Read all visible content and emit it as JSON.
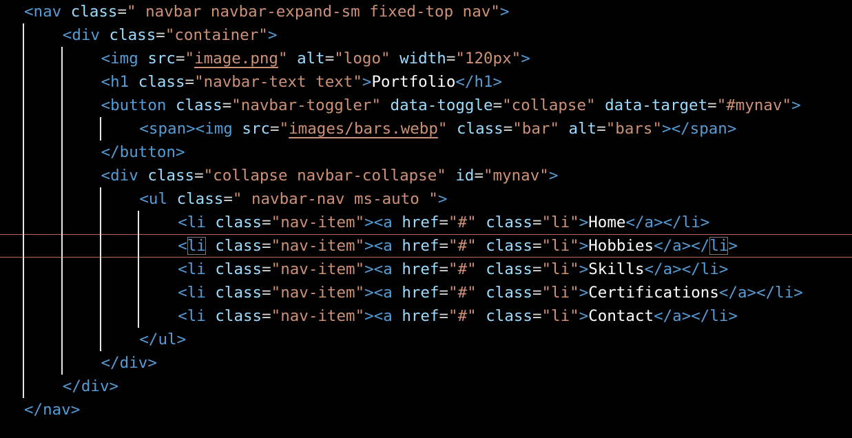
{
  "editor": {
    "lines": [
      [
        [
          "tag",
          "<nav "
        ],
        [
          "attr",
          "class"
        ],
        [
          "pun",
          "="
        ],
        [
          "str",
          "\" navbar navbar-expand-sm fixed-top nav\""
        ],
        [
          "tag",
          ">"
        ]
      ],
      [
        [
          "tag",
          "<div "
        ],
        [
          "attr",
          "class"
        ],
        [
          "pun",
          "="
        ],
        [
          "str",
          "\"container\""
        ],
        [
          "tag",
          ">"
        ]
      ],
      [
        [
          "tag",
          "<img "
        ],
        [
          "attr",
          "src"
        ],
        [
          "pun",
          "="
        ],
        [
          "str",
          "\""
        ],
        [
          "str",
          "image.png",
          "link"
        ],
        [
          "str",
          "\""
        ],
        [
          "pun",
          " "
        ],
        [
          "attr",
          "alt"
        ],
        [
          "pun",
          "="
        ],
        [
          "str",
          "\"logo\""
        ],
        [
          "pun",
          " "
        ],
        [
          "attr",
          "width"
        ],
        [
          "pun",
          "="
        ],
        [
          "str",
          "\"120px\""
        ],
        [
          "tag",
          ">"
        ]
      ],
      [
        [
          "tag",
          "<h1 "
        ],
        [
          "attr",
          "class"
        ],
        [
          "pun",
          "="
        ],
        [
          "str",
          "\"navbar-text text\""
        ],
        [
          "tag",
          ">"
        ],
        [
          "txt",
          "Portfolio"
        ],
        [
          "tag",
          "</h1>"
        ]
      ],
      [
        [
          "tag",
          "<button "
        ],
        [
          "attr",
          "class"
        ],
        [
          "pun",
          "="
        ],
        [
          "str",
          "\"navbar-toggler\""
        ],
        [
          "pun",
          " "
        ],
        [
          "attr",
          "data-toggle"
        ],
        [
          "pun",
          "="
        ],
        [
          "str",
          "\"collapse\""
        ],
        [
          "pun",
          " "
        ],
        [
          "attr",
          "data-target"
        ],
        [
          "pun",
          "="
        ],
        [
          "str",
          "\"#mynav\""
        ],
        [
          "tag",
          ">"
        ]
      ],
      [
        [
          "tag",
          "<span>"
        ],
        [
          "tag",
          "<img "
        ],
        [
          "attr",
          "src"
        ],
        [
          "pun",
          "="
        ],
        [
          "str",
          "\""
        ],
        [
          "str",
          "images/bars.webp",
          "link"
        ],
        [
          "str",
          "\""
        ],
        [
          "pun",
          " "
        ],
        [
          "attr",
          "class"
        ],
        [
          "pun",
          "="
        ],
        [
          "str",
          "\"bar\""
        ],
        [
          "pun",
          " "
        ],
        [
          "attr",
          "alt"
        ],
        [
          "pun",
          "="
        ],
        [
          "str",
          "\"bars\""
        ],
        [
          "tag",
          ">"
        ],
        [
          "tag",
          "</span>"
        ]
      ],
      [
        [
          "tag",
          "</button>"
        ]
      ],
      [
        [
          "tag",
          "<div "
        ],
        [
          "attr",
          "class"
        ],
        [
          "pun",
          "="
        ],
        [
          "str",
          "\"collapse navbar-collapse\""
        ],
        [
          "pun",
          " "
        ],
        [
          "attr",
          "id"
        ],
        [
          "pun",
          "="
        ],
        [
          "str",
          "\"mynav\""
        ],
        [
          "tag",
          ">"
        ]
      ],
      [
        [
          "tag",
          "<ul "
        ],
        [
          "attr",
          "class"
        ],
        [
          "pun",
          "="
        ],
        [
          "str",
          "\" navbar-nav ms-auto \""
        ],
        [
          "tag",
          ">"
        ]
      ],
      [
        [
          "tag",
          "<li "
        ],
        [
          "attr",
          "class"
        ],
        [
          "pun",
          "="
        ],
        [
          "str",
          "\"nav-item\""
        ],
        [
          "tag",
          ">"
        ],
        [
          "tag",
          "<a "
        ],
        [
          "attr",
          "href"
        ],
        [
          "pun",
          "="
        ],
        [
          "str",
          "\"#\""
        ],
        [
          "pun",
          " "
        ],
        [
          "attr",
          "class"
        ],
        [
          "pun",
          "="
        ],
        [
          "str",
          "\"li\""
        ],
        [
          "tag",
          ">"
        ],
        [
          "txt",
          "Home"
        ],
        [
          "tag",
          "</a>"
        ],
        [
          "tag",
          "</li>"
        ]
      ],
      [
        [
          "tag",
          "<"
        ],
        [
          "tag",
          "li",
          "pair"
        ],
        [
          "pun",
          " "
        ],
        [
          "attr",
          "class"
        ],
        [
          "pun",
          "="
        ],
        [
          "str",
          "\"nav-item\""
        ],
        [
          "tag",
          ">"
        ],
        [
          "tag",
          "<a "
        ],
        [
          "attr",
          "href"
        ],
        [
          "pun",
          "="
        ],
        [
          "str",
          "\"#\""
        ],
        [
          "pun",
          " "
        ],
        [
          "attr",
          "class"
        ],
        [
          "pun",
          "="
        ],
        [
          "str",
          "\"li\""
        ],
        [
          "tag",
          ">"
        ],
        [
          "txt",
          "Hobbies"
        ],
        [
          "tag",
          "</a>"
        ],
        [
          "tag",
          "</"
        ],
        [
          "tag",
          "li",
          "pair"
        ],
        [
          "tag",
          ">"
        ]
      ],
      [
        [
          "tag",
          "<li "
        ],
        [
          "attr",
          "class"
        ],
        [
          "pun",
          "="
        ],
        [
          "str",
          "\"nav-item\""
        ],
        [
          "tag",
          ">"
        ],
        [
          "tag",
          "<a "
        ],
        [
          "attr",
          "href"
        ],
        [
          "pun",
          "="
        ],
        [
          "str",
          "\"#\""
        ],
        [
          "pun",
          " "
        ],
        [
          "attr",
          "class"
        ],
        [
          "pun",
          "="
        ],
        [
          "str",
          "\"li\""
        ],
        [
          "tag",
          ">"
        ],
        [
          "txt",
          "Skills"
        ],
        [
          "tag",
          "</a>"
        ],
        [
          "tag",
          "</li>"
        ]
      ],
      [
        [
          "tag",
          "<li "
        ],
        [
          "attr",
          "class"
        ],
        [
          "pun",
          "="
        ],
        [
          "str",
          "\"nav-item\""
        ],
        [
          "tag",
          ">"
        ],
        [
          "tag",
          "<a "
        ],
        [
          "attr",
          "href"
        ],
        [
          "pun",
          "="
        ],
        [
          "str",
          "\"#\""
        ],
        [
          "pun",
          " "
        ],
        [
          "attr",
          "class"
        ],
        [
          "pun",
          "="
        ],
        [
          "str",
          "\"li\""
        ],
        [
          "tag",
          ">"
        ],
        [
          "txt",
          "Certifications"
        ],
        [
          "tag",
          "</a>"
        ],
        [
          "tag",
          "</li>"
        ]
      ],
      [
        [
          "tag",
          "<li "
        ],
        [
          "attr",
          "class"
        ],
        [
          "pun",
          "="
        ],
        [
          "str",
          "\"nav-item\""
        ],
        [
          "tag",
          ">"
        ],
        [
          "tag",
          "<a "
        ],
        [
          "attr",
          "href"
        ],
        [
          "pun",
          "="
        ],
        [
          "str",
          "\"#\""
        ],
        [
          "pun",
          " "
        ],
        [
          "attr",
          "class"
        ],
        [
          "pun",
          "="
        ],
        [
          "str",
          "\"li\""
        ],
        [
          "tag",
          ">"
        ],
        [
          "txt",
          "Contact"
        ],
        [
          "tag",
          "</a>"
        ],
        [
          "tag",
          "</li>"
        ]
      ],
      [
        [
          "tag",
          "</ul>"
        ]
      ],
      [
        [
          "tag",
          "</div>"
        ]
      ],
      [
        [
          "tag",
          "</div>"
        ]
      ],
      [
        [
          "tag",
          "</nav>"
        ]
      ]
    ],
    "indent_levels": [
      0,
      1,
      2,
      2,
      2,
      3,
      2,
      2,
      3,
      4,
      4,
      4,
      4,
      4,
      3,
      2,
      1,
      0
    ],
    "current_line": 10,
    "colors": {
      "background": "#000000",
      "tag": "#569cd6",
      "attribute": "#9cdcfe",
      "string": "#ce9178",
      "text": "#ffffff",
      "punctuation": "#d4d4d4",
      "indent_guide": "#e8e8e8",
      "current_line_border": "#b0664c"
    }
  }
}
